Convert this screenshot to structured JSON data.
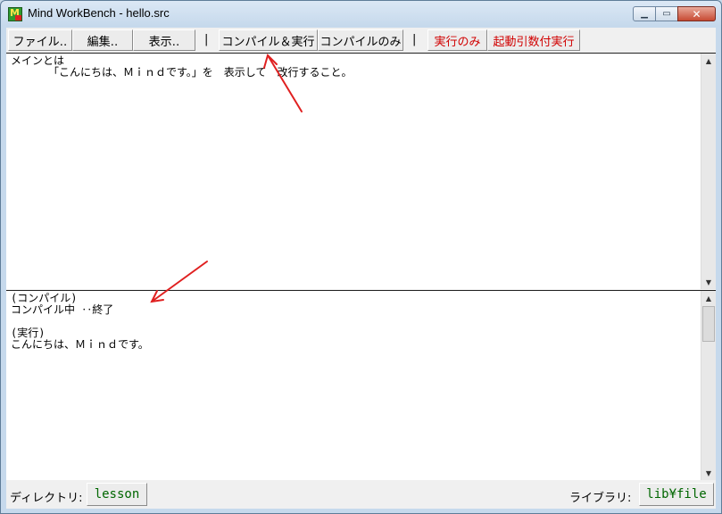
{
  "window": {
    "title": "Mind WorkBench - hello.src"
  },
  "toolbar": {
    "file": "ファイル‥",
    "edit": "編集‥",
    "view": "表示‥",
    "sep": "|",
    "compile_run": "コンパイル＆実行",
    "compile_only": "コンパイルのみ",
    "run_only": "実行のみ",
    "run_with_args": "起動引数付実行"
  },
  "editor": {
    "text": "メインとは\n　　　　「こんにちは、Ｍｉｎｄです。」を　表示して　改行すること。"
  },
  "output": {
    "text": "(コンパイル)\nコンパイル中 ‥終了\n\n(実行)\nこんにちは、Ｍｉｎｄです。"
  },
  "status": {
    "dir_label": "ディレクトリ:",
    "dir_value": "lesson",
    "lib_label": "ライブラリ:",
    "lib_value": "lib¥file"
  },
  "colors": {
    "run_buttons": "#d10000",
    "status_values": "#006600",
    "annotation_arrows": "#e02020"
  }
}
